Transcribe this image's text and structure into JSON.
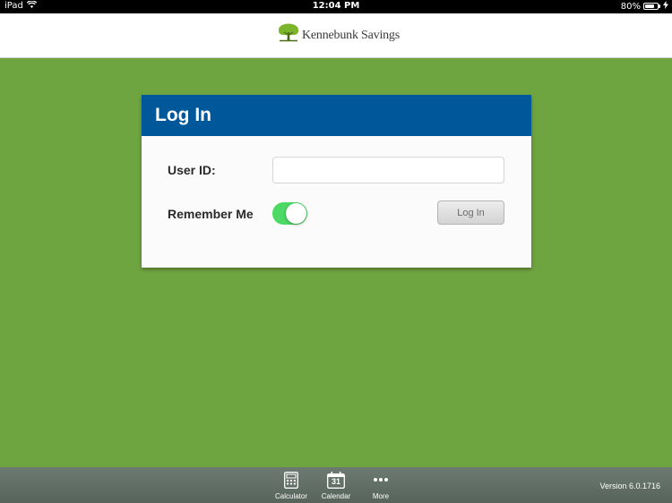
{
  "status_bar": {
    "device": "iPad",
    "time": "12:04 PM",
    "battery_percent": "80%",
    "battery_level": 0.8
  },
  "header": {
    "logo_text": "Kennebunk Savings",
    "logo_icon": "tree-icon",
    "brand_color": "#6fa540"
  },
  "login_card": {
    "title": "Log In",
    "header_color": "#00579a",
    "userid_label": "User ID:",
    "userid_value": "",
    "remember_label": "Remember Me",
    "remember_on": true,
    "login_button_label": "Log In"
  },
  "bottom_bar": {
    "tabs": [
      {
        "label": "Calculator",
        "icon": "calculator-icon"
      },
      {
        "label": "Calendar",
        "icon": "calendar-icon",
        "icon_text": "31"
      },
      {
        "label": "More",
        "icon": "more-icon"
      }
    ],
    "version": "Version 6.0.1716"
  }
}
